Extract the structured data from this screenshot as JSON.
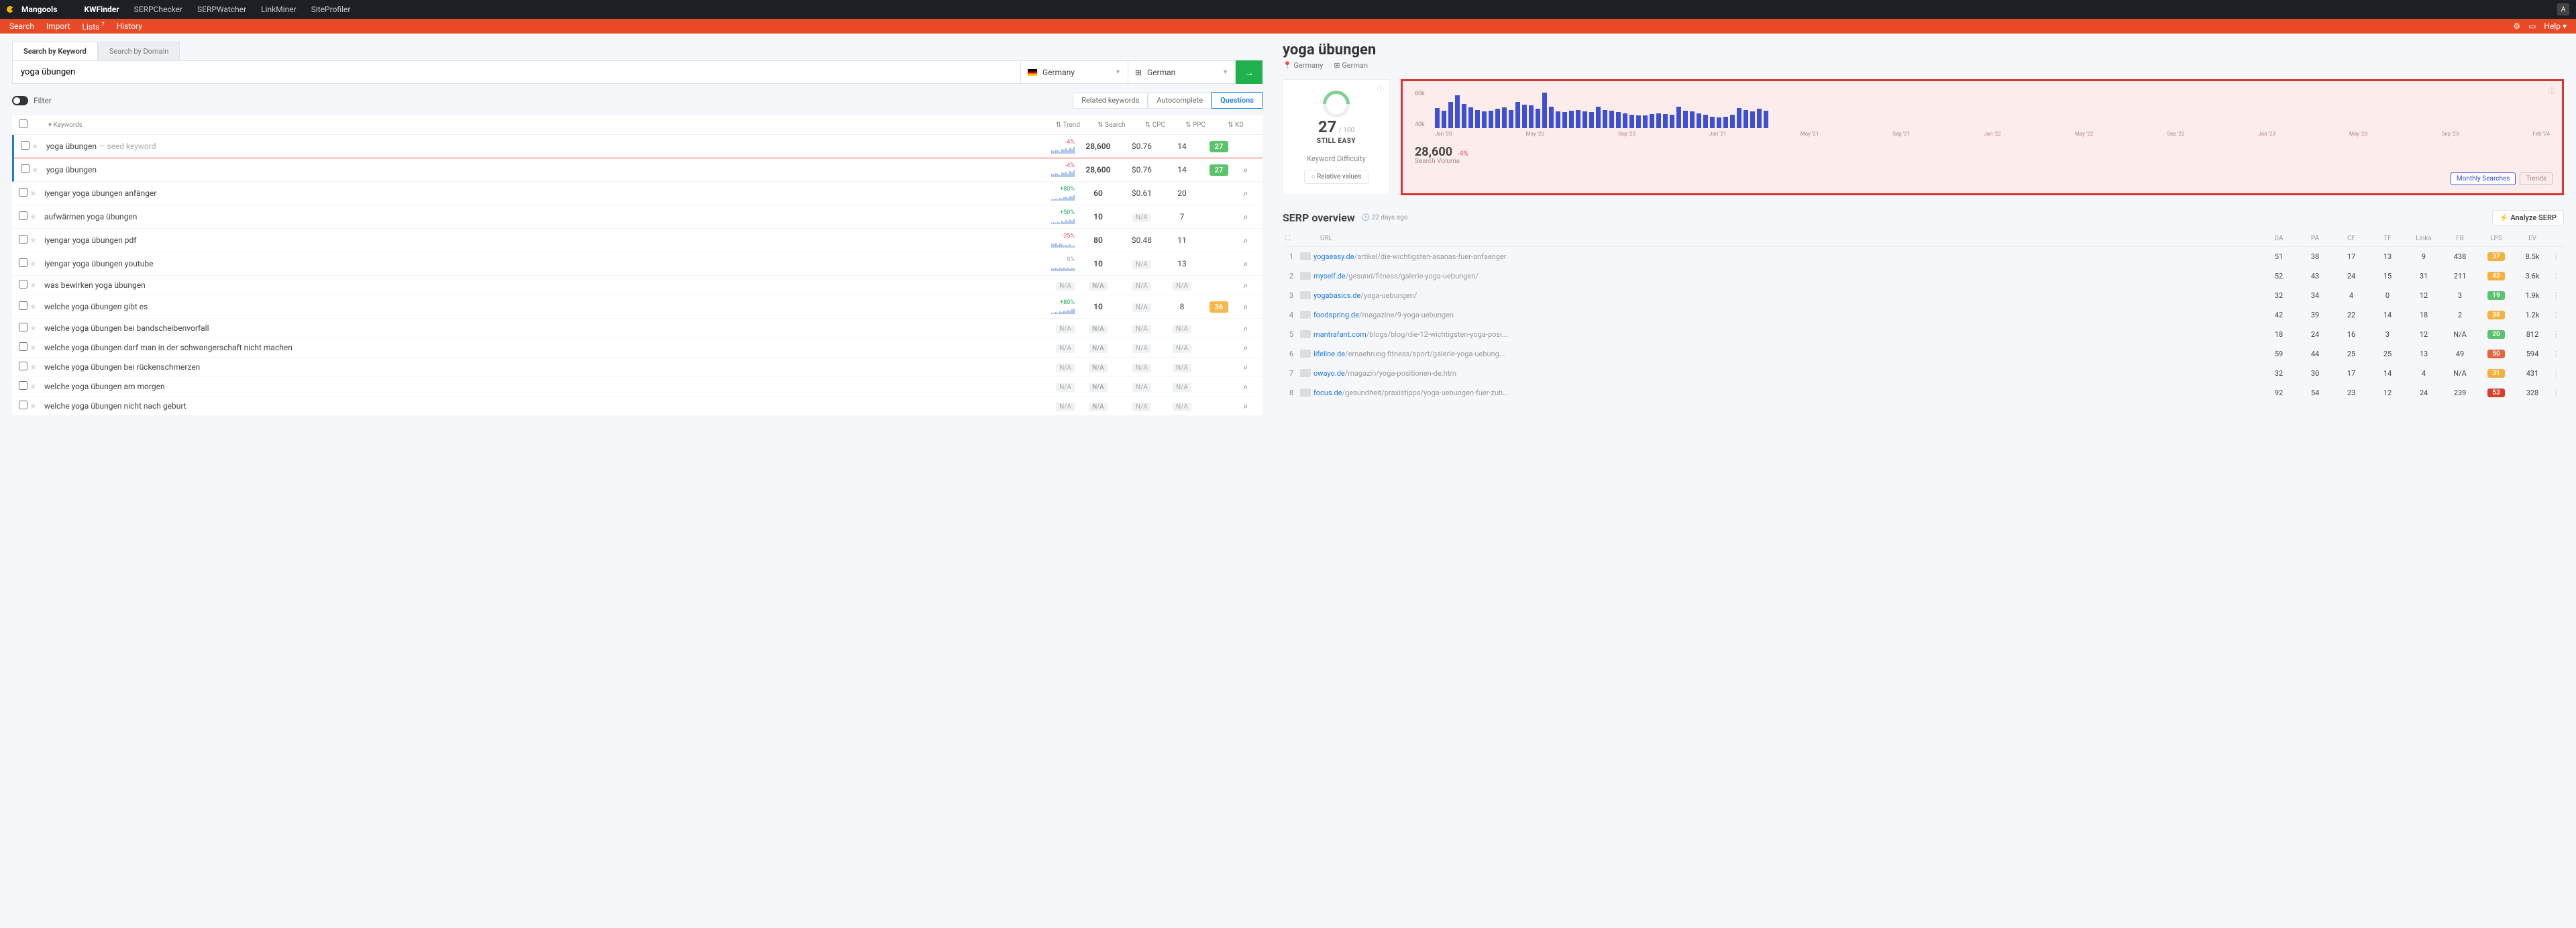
{
  "topnav": {
    "brand": "Mangools",
    "items": [
      "KWFinder",
      "SERPChecker",
      "SERPWatcher",
      "LinkMiner",
      "SiteProfiler"
    ],
    "active": "KWFinder",
    "avatar": "A"
  },
  "subnav": {
    "items": [
      "Search",
      "Import",
      "Lists",
      "History"
    ],
    "lists_badge": "7",
    "help": "Help"
  },
  "tabs": {
    "kw": "Search by Keyword",
    "dom": "Search by Domain"
  },
  "search": {
    "value": "yoga übungen",
    "location": "Germany",
    "language": "German"
  },
  "filter_label": "Filter",
  "pills": {
    "related": "Related keywords",
    "auto": "Autocomplete",
    "q": "Questions"
  },
  "kh": {
    "kw": "Keywords",
    "trend": "Trend",
    "search": "Search",
    "cpc": "CPC",
    "ppc": "PPC",
    "kd": "KD"
  },
  "rows": [
    {
      "kw": "yoga übungen",
      "seed": true,
      "sel": true,
      "trend": "-4%",
      "tcls": "neg",
      "spark": [
        5,
        4,
        6,
        5,
        3,
        7,
        6,
        8,
        5,
        9,
        7,
        10
      ],
      "search": "28,600",
      "cpc": "$0.76",
      "ppc": "14",
      "kd": "27",
      "kdcls": "g",
      "act": ""
    },
    {
      "kw": "yoga übungen",
      "sel": true,
      "trend": "-4%",
      "tcls": "neg",
      "spark": [
        5,
        4,
        6,
        5,
        3,
        7,
        6,
        8,
        5,
        9,
        7,
        10
      ],
      "search": "28,600",
      "cpc": "$0.76",
      "ppc": "14",
      "kd": "27",
      "kdcls": "g",
      "act": "⌕"
    },
    {
      "kw": "iyengar yoga übungen anfänger",
      "trend": "+80%",
      "tcls": "pos",
      "spark": [
        2,
        2,
        3,
        2,
        4,
        3,
        5,
        6,
        4,
        7,
        6,
        8
      ],
      "search": "60",
      "cpc": "$0.61",
      "ppc": "20",
      "act": "⌕"
    },
    {
      "kw": "aufwärmen yoga übungen",
      "trend": "+50%",
      "tcls": "pos",
      "spark": [
        2,
        3,
        2,
        4,
        2,
        5,
        3,
        6,
        4,
        7,
        5,
        8
      ],
      "search": "10",
      "cpc": "N/A",
      "ppc": "7",
      "act": "⌕"
    },
    {
      "kw": "iyengar yoga übungen pdf",
      "trend": "-25%",
      "tcls": "neg",
      "spark": [
        6,
        5,
        7,
        4,
        6,
        5,
        3,
        4,
        3,
        5,
        2,
        3
      ],
      "search": "80",
      "cpc": "$0.48",
      "ppc": "11",
      "act": "⌕"
    },
    {
      "kw": "iyengar yoga übungen youtube",
      "trend": "0%",
      "tcls": "zero",
      "spark": [
        4,
        4,
        5,
        3,
        5,
        4,
        5,
        4,
        5,
        3,
        5,
        4
      ],
      "search": "10",
      "cpc": "N/A",
      "ppc": "13",
      "act": "⌕"
    },
    {
      "kw": "was bewirken yoga übungen",
      "trend": "N/A",
      "search": "N/A",
      "cpc": "N/A",
      "ppc": "N/A",
      "act": "⌕"
    },
    {
      "kw": "welche yoga übungen gibt es",
      "trend": "+80%",
      "tcls": "pos",
      "spark": [
        2,
        2,
        3,
        2,
        4,
        3,
        5,
        4,
        6,
        5,
        7,
        8
      ],
      "search": "10",
      "cpc": "N/A",
      "ppc": "8",
      "kd": "36",
      "kdcls": "o",
      "act": "⌕"
    },
    {
      "kw": "welche yoga übungen bei bandscheibenvorfall",
      "trend": "N/A",
      "search": "N/A",
      "cpc": "N/A",
      "ppc": "N/A",
      "act": "⌕"
    },
    {
      "kw": "welche yoga übungen darf man in der schwangerschaft nicht machen",
      "trend": "N/A",
      "search": "N/A",
      "cpc": "N/A",
      "ppc": "N/A",
      "act": "⌕"
    },
    {
      "kw": "welche yoga übungen bei rückenschmerzen",
      "trend": "N/A",
      "search": "N/A",
      "cpc": "N/A",
      "ppc": "N/A",
      "act": "⌕"
    },
    {
      "kw": "welche yoga übungen am morgen",
      "trend": "N/A",
      "search": "N/A",
      "cpc": "N/A",
      "ppc": "N/A",
      "act": "⌕"
    },
    {
      "kw": "welche yoga übungen nicht nach geburt",
      "trend": "N/A",
      "search": "N/A",
      "cpc": "N/A",
      "ppc": "N/A",
      "act": "⌕"
    }
  ],
  "seed_tag": "— seed keyword",
  "right": {
    "title": "yoga übungen",
    "loc": "Germany",
    "lang": "German",
    "kd": {
      "num": "27",
      "of": "/ 100",
      "status": "STILL EASY",
      "label": "Keyword Difficulty",
      "rel": "Relative values"
    },
    "chart": {
      "y": [
        "80k",
        "40k"
      ],
      "x": [
        "Jan '20",
        "May '20",
        "Sep '20",
        "Jan '21",
        "May '21",
        "Sep '21",
        "Jan '22",
        "May '22",
        "Sep '22",
        "Jan '23",
        "May '23",
        "Sep '23",
        "Feb '24"
      ],
      "sv": "28,600",
      "svpct": "-4%",
      "svlabel": "Search Volume",
      "b1": "Monthly Searches",
      "b2": "Trends"
    },
    "serp": {
      "title": "SERP overview",
      "ago": "22 days ago",
      "analyze": "Analyze SERP",
      "head": {
        "url": "URL",
        "da": "DA",
        "pa": "PA",
        "cf": "CF",
        "tf": "TF",
        "links": "Links",
        "fb": "FB",
        "lps": "LPS",
        "ev": "EV"
      },
      "rows": [
        {
          "r": 1,
          "dom": "yogaeasy.de",
          "path": "/artikel/die-wichtigsten-asanas-fuer-anfaenger",
          "da": 51,
          "pa": 38,
          "cf": 17,
          "tf": 13,
          "links": 9,
          "fb": 438,
          "lps": 37,
          "lc": "y",
          "ev": "8.5k"
        },
        {
          "r": 2,
          "dom": "myself.de",
          "path": "/gesund/fitness/galerie-yoga-uebungen/",
          "da": 52,
          "pa": 43,
          "cf": 24,
          "tf": 15,
          "links": 31,
          "fb": 211,
          "lps": 43,
          "lc": "y",
          "ev": "3.6k"
        },
        {
          "r": 3,
          "dom": "yogabasics.de",
          "path": "/yoga-uebungen/",
          "da": 32,
          "pa": 34,
          "cf": 4,
          "tf": 0,
          "links": 12,
          "fb": 3,
          "lps": 19,
          "lc": "g",
          "ev": "1.9k"
        },
        {
          "r": 4,
          "dom": "foodspring.de",
          "path": "/magazine/9-yoga-uebungen",
          "da": 42,
          "pa": 39,
          "cf": 22,
          "tf": 14,
          "links": 18,
          "fb": 2,
          "lps": 38,
          "lc": "y",
          "ev": "1.2k"
        },
        {
          "r": 5,
          "dom": "mantrafant.com",
          "path": "/blogs/blog/die-12-wichtigsten-yoga-posi...",
          "da": 18,
          "pa": 24,
          "cf": 16,
          "tf": 3,
          "links": 12,
          "fb": "N/A",
          "lps": 20,
          "lc": "g",
          "ev": "812"
        },
        {
          "r": 6,
          "dom": "lifeline.de",
          "path": "/ernaehrung-fitness/sport/galerie-yoga-uebung...",
          "da": 59,
          "pa": 44,
          "cf": 25,
          "tf": 25,
          "links": 13,
          "fb": 49,
          "lps": 50,
          "lc": "r",
          "ev": "594"
        },
        {
          "r": 7,
          "dom": "owayo.de",
          "path": "/magazin/yoga-positionen-de.htm",
          "da": 32,
          "pa": 30,
          "cf": 17,
          "tf": 14,
          "links": 4,
          "fb": "N/A",
          "lps": 31,
          "lc": "y",
          "ev": "431"
        },
        {
          "r": 8,
          "dom": "focus.de",
          "path": "/gesundheit/praxistipps/yoga-uebungen-fuer-zuh...",
          "da": 92,
          "pa": 54,
          "cf": 23,
          "tf": 12,
          "links": 24,
          "fb": 239,
          "lps": 53,
          "lc": "dr",
          "ev": "328"
        }
      ]
    }
  },
  "chart_data": {
    "type": "bar",
    "title": "Monthly Searches",
    "ylabel": "Search volume",
    "ylim": [
      0,
      90000
    ],
    "x": [
      "Jan '20",
      "Feb '20",
      "Mar '20",
      "Apr '20",
      "May '20",
      "Jun '20",
      "Jul '20",
      "Aug '20",
      "Sep '20",
      "Oct '20",
      "Nov '20",
      "Dec '20",
      "Jan '21",
      "Feb '21",
      "Mar '21",
      "Apr '21",
      "May '21",
      "Jun '21",
      "Jul '21",
      "Aug '21",
      "Sep '21",
      "Oct '21",
      "Nov '21",
      "Dec '21",
      "Jan '22",
      "Feb '22",
      "Mar '22",
      "Apr '22",
      "May '22",
      "Jun '22",
      "Jul '22",
      "Aug '22",
      "Sep '22",
      "Oct '22",
      "Nov '22",
      "Dec '22",
      "Jan '23",
      "Feb '23",
      "Mar '23",
      "Apr '23",
      "May '23",
      "Jun '23",
      "Jul '23",
      "Aug '23",
      "Sep '23",
      "Oct '23",
      "Nov '23",
      "Dec '23",
      "Jan '24",
      "Feb '24"
    ],
    "values": [
      48000,
      42000,
      62000,
      78000,
      58000,
      50000,
      44000,
      40000,
      42000,
      46000,
      50000,
      44000,
      62000,
      56000,
      54000,
      46000,
      86000,
      52000,
      40000,
      38000,
      42000,
      44000,
      40000,
      38000,
      52000,
      44000,
      42000,
      38000,
      36000,
      32000,
      30000,
      30000,
      34000,
      36000,
      34000,
      32000,
      52000,
      42000,
      40000,
      36000,
      32000,
      28000,
      26000,
      28000,
      32000,
      48000,
      44000,
      40000,
      46000,
      42000
    ]
  }
}
